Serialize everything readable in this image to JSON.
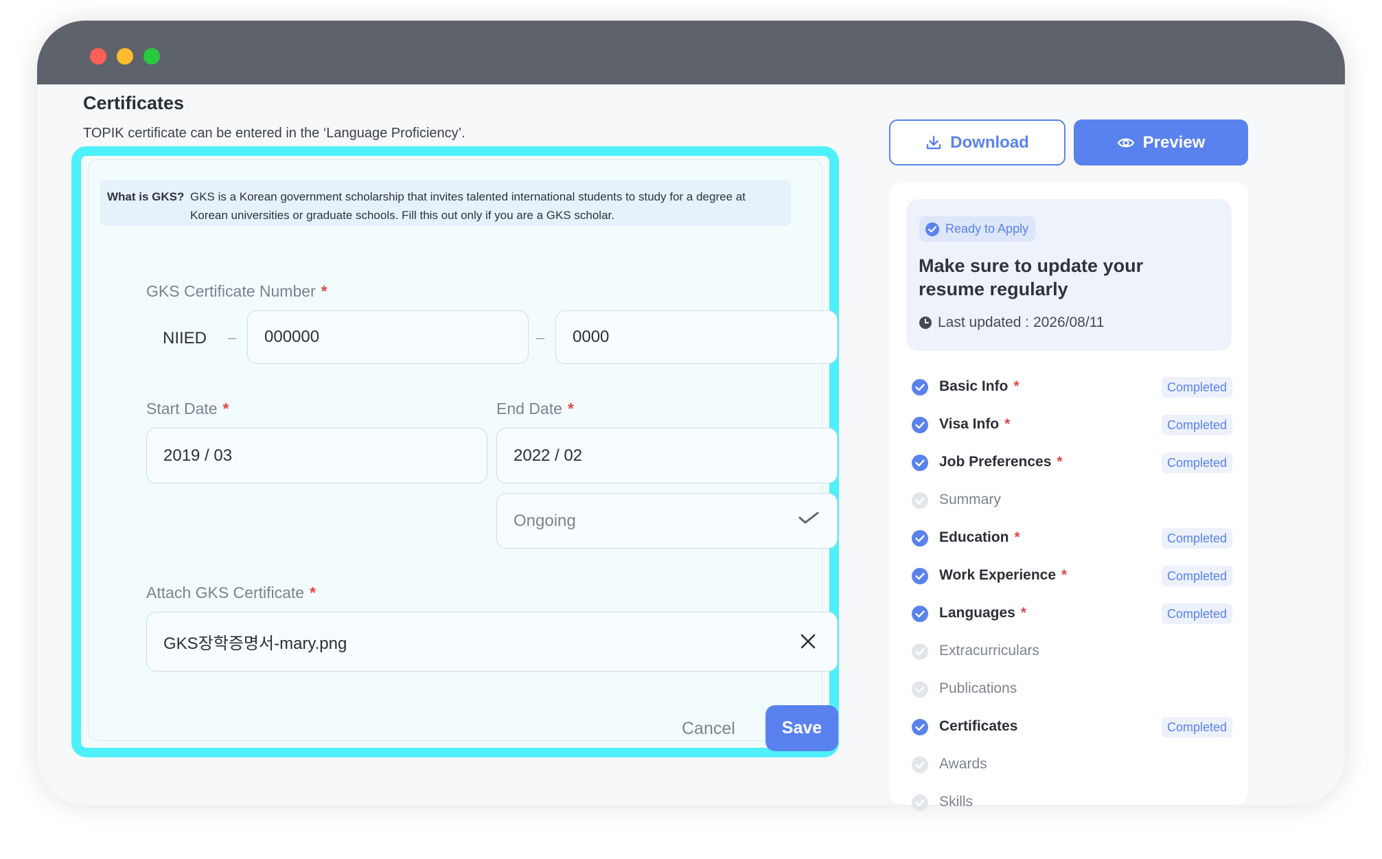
{
  "section": {
    "title": "Certificates",
    "subtitle": "TOPIK certificate can be entered in the ‘Language Proficiency’."
  },
  "notice": {
    "question": "What is GKS?",
    "text": "GKS is a Korean government scholarship that invites talented international students to study for a degree at Korean universities or graduate schools. Fill this out only if you are a GKS scholar."
  },
  "form": {
    "cert_number_label": "GKS Certificate Number",
    "cert_prefix": "NIIED",
    "cert_separator": "–",
    "cert_part1": "000000",
    "cert_part2": "0000",
    "start_label": "Start Date",
    "start_value": "2019  / 03",
    "end_label": "End Date",
    "end_value": "2022  / 02",
    "ongoing_label": "Ongoing",
    "attach_label": "Attach GKS Certificate",
    "attach_file": "GKS장학증명서-mary.png",
    "required_mark": "*",
    "cancel_label": "Cancel",
    "save_label": "Save"
  },
  "actions": {
    "download_label": "Download",
    "preview_label": "Preview"
  },
  "status": {
    "badge": "Ready to Apply",
    "title": "Make sure to update your resume regularly",
    "last_updated": "Last updated : 2026/08/11"
  },
  "nav": [
    {
      "label": "Basic Info",
      "required": "*",
      "status": "Completed",
      "done": true
    },
    {
      "label": "Visa Info",
      "required": "*",
      "status": "Completed",
      "done": true
    },
    {
      "label": "Job Preferences",
      "required": "*",
      "status": "Completed",
      "done": true
    },
    {
      "label": "Summary",
      "required": "",
      "status": "",
      "done": false
    },
    {
      "label": "Education",
      "required": "*",
      "status": "Completed",
      "done": true
    },
    {
      "label": "Work Experience",
      "required": "*",
      "status": "Completed",
      "done": true
    },
    {
      "label": "Languages",
      "required": "*",
      "status": "Completed",
      "done": true
    },
    {
      "label": "Extracurriculars",
      "required": "",
      "status": "",
      "done": false
    },
    {
      "label": "Publications",
      "required": "",
      "status": "",
      "done": false
    },
    {
      "label": "Certificates",
      "required": "",
      "status": "Completed",
      "done": true
    },
    {
      "label": "Awards",
      "required": "",
      "status": "",
      "done": false
    },
    {
      "label": "Skills",
      "required": "",
      "status": "",
      "done": false
    }
  ],
  "colors": {
    "accent": "#5a82ee",
    "highlight_border": "#4ef0fa",
    "required": "#e04848",
    "titlebar": "#5e626a"
  }
}
